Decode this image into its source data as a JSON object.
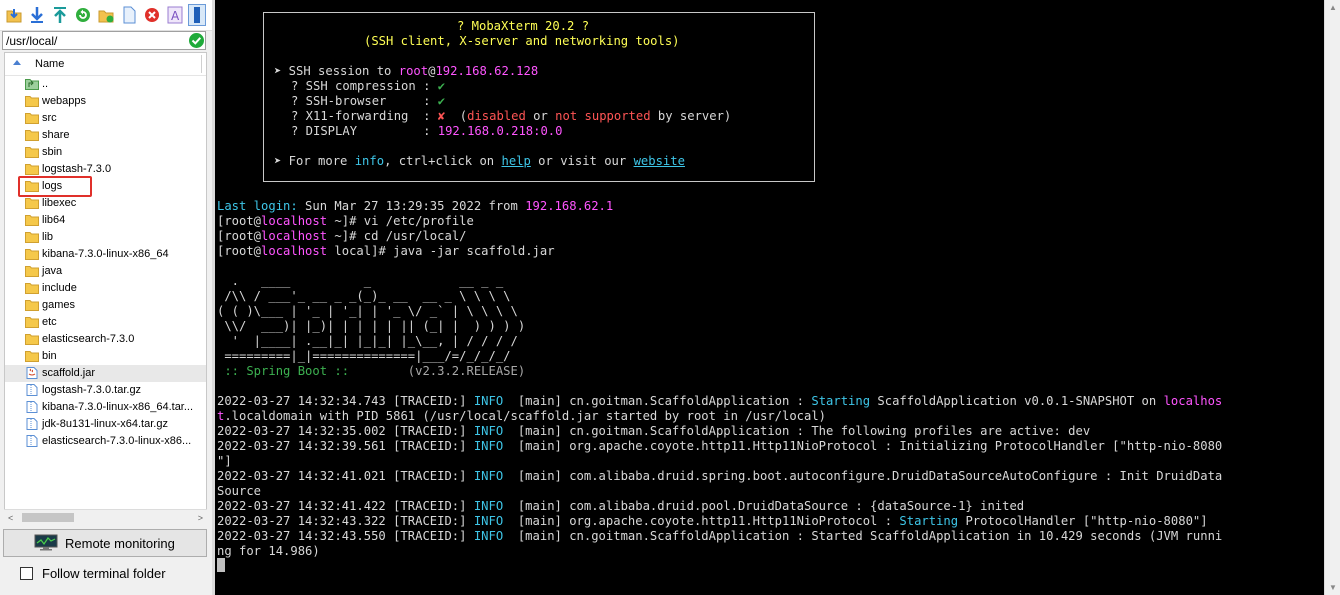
{
  "sidebar": {
    "path": "/usr/local/",
    "column_name": "Name",
    "items": [
      {
        "label": "..",
        "type": "up"
      },
      {
        "label": "webapps",
        "type": "folder"
      },
      {
        "label": "src",
        "type": "folder"
      },
      {
        "label": "share",
        "type": "folder"
      },
      {
        "label": "sbin",
        "type": "folder"
      },
      {
        "label": "logstash-7.3.0",
        "type": "folder"
      },
      {
        "label": "logs",
        "type": "folder"
      },
      {
        "label": "libexec",
        "type": "folder"
      },
      {
        "label": "lib64",
        "type": "folder"
      },
      {
        "label": "lib",
        "type": "folder"
      },
      {
        "label": "kibana-7.3.0-linux-x86_64",
        "type": "folder"
      },
      {
        "label": "java",
        "type": "folder"
      },
      {
        "label": "include",
        "type": "folder"
      },
      {
        "label": "games",
        "type": "folder"
      },
      {
        "label": "etc",
        "type": "folder"
      },
      {
        "label": "elasticsearch-7.3.0",
        "type": "folder"
      },
      {
        "label": "bin",
        "type": "folder"
      },
      {
        "label": "scaffold.jar",
        "type": "jar"
      },
      {
        "label": "logstash-7.3.0.tar.gz",
        "type": "archive"
      },
      {
        "label": "kibana-7.3.0-linux-x86_64.tar...",
        "type": "archive"
      },
      {
        "label": "jdk-8u131-linux-x64.tar.gz",
        "type": "archive"
      },
      {
        "label": "elasticsearch-7.3.0-linux-x86...",
        "type": "archive"
      }
    ],
    "remote_monitoring_label": "Remote monitoring",
    "follow_terminal_label": "Follow terminal folder",
    "colors": {
      "folder": "#f5c84a",
      "highlight": "#e0302a"
    }
  },
  "toolbar_icons": [
    "download-folder-icon",
    "download-icon",
    "upload-icon",
    "refresh-icon",
    "new-folder-icon",
    "new-file-icon",
    "delete-icon",
    "rename-icon",
    "terminal-toggle-icon"
  ],
  "terminal": {
    "banner": {
      "title": "? MobaXterm 20.2 ?",
      "subtitle": "(SSH client, X-server and networking tools)",
      "ssh_session_prefix": "➤ SSH session to ",
      "ssh_user": "root",
      "ssh_at": "@",
      "ssh_host": "192.168.62.128",
      "compression_label": "? SSH compression : ",
      "browser_label": "? SSH-browser     : ",
      "check": "✔",
      "x11_label": "? X11-forwarding  : ",
      "cross": "✘",
      "x11_open": "  (",
      "disabled": "disabled",
      "x11_or": " or ",
      "not_supported": "not supported",
      "x11_tail": " by server)",
      "display_label": "? DISPLAY         : ",
      "display_value": "192.168.0.218:0.0",
      "more_prefix": "➤ For more ",
      "more_info": "info",
      "more_mid": ", ctrl+click on ",
      "more_help": "help",
      "more_mid2": " or visit our ",
      "more_website": "website"
    },
    "last_login_label": "Last login:",
    "last_login_text": " Sun Mar 27 13:29:35 2022 from ",
    "last_login_ip": "192.168.62.1",
    "prompts": [
      {
        "pre": "[root@",
        "host": "localhost",
        "post": " ~]# vi /etc/profile"
      },
      {
        "pre": "[root@",
        "host": "localhost",
        "post": " ~]# cd /usr/local/"
      },
      {
        "pre": "[root@",
        "host": "localhost",
        "post": " local]# java -jar scaffold.jar"
      }
    ],
    "ascii_art": [
      "  .   ____          _            __ _ _",
      " /\\\\ / ___'_ __ _ _(_)_ __  __ _ \\ \\ \\ \\",
      "( ( )\\___ | '_ | '_| | '_ \\/ _` | \\ \\ \\ \\",
      " \\\\/  ___)| |_)| | | | | || (_| |  ) ) ) )",
      "  '  |____| .__|_| |_|_| |_\\__, | / / / /",
      " =========|_|==============|___/=/_/_/_/"
    ],
    "spring_label": " :: Spring Boot :: ",
    "spring_version": "       (v2.3.2.RELEASE)",
    "logs": [
      {
        "ts": "2022-03-27 14:32:34.743 [TRACEID:] ",
        "level": "INFO",
        "msg": "  [main] cn.goitman.ScaffoldApplication : ",
        "hl": "Starting",
        "msg2": " ScaffoldApplication v0.0.1-SNAPSHOT on ",
        "host": "localhos"
      },
      {
        "cont": true,
        "host": "t",
        "msg": ".localdomain with PID 5861 (/usr/local/scaffold.jar started by root in /usr/local)"
      },
      {
        "ts": "2022-03-27 14:32:35.002 [TRACEID:] ",
        "level": "INFO",
        "msg": "  [main] cn.goitman.ScaffoldApplication : The following profiles are active: dev"
      },
      {
        "ts": "2022-03-27 14:32:39.561 [TRACEID:] ",
        "level": "INFO",
        "msg": "  [main] org.apache.coyote.http11.Http11NioProtocol : Initializing ProtocolHandler [\"http-nio-8080"
      },
      {
        "cont": true,
        "msg": "\"]"
      },
      {
        "ts": "2022-03-27 14:32:41.021 [TRACEID:] ",
        "level": "INFO",
        "msg": "  [main] com.alibaba.druid.spring.boot.autoconfigure.DruidDataSourceAutoConfigure : Init DruidData"
      },
      {
        "cont": true,
        "msg": "Source"
      },
      {
        "ts": "2022-03-27 14:32:41.422 [TRACEID:] ",
        "level": "INFO",
        "msg": "  [main] com.alibaba.druid.pool.DruidDataSource : {dataSource-1} inited"
      },
      {
        "ts": "2022-03-27 14:32:43.322 [TRACEID:] ",
        "level": "INFO",
        "msg": "  [main] org.apache.coyote.http11.Http11NioProtocol : ",
        "hl": "Starting",
        "msg2": " ProtocolHandler [\"http-nio-8080\"]"
      },
      {
        "ts": "2022-03-27 14:32:43.550 [TRACEID:] ",
        "level": "INFO",
        "msg": "  [main] cn.goitman.ScaffoldApplication : Started ScaffoldApplication in 10.429 seconds (JVM runni"
      },
      {
        "cont": true,
        "msg": "ng for 14.986)"
      }
    ]
  }
}
